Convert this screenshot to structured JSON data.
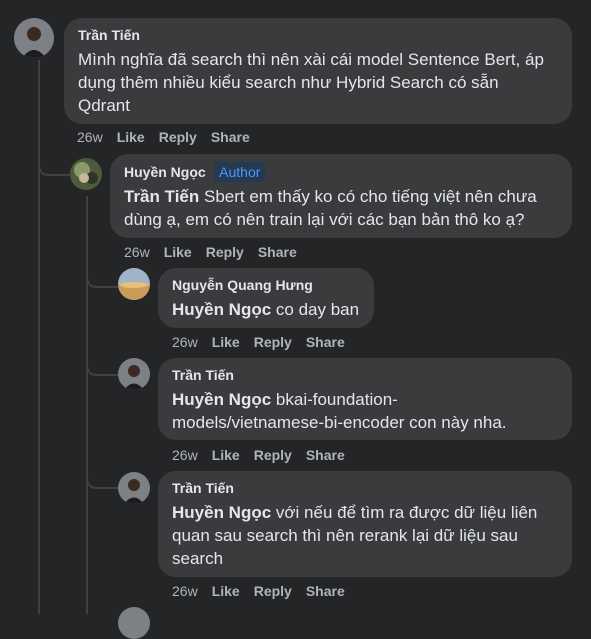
{
  "comments": [
    {
      "author": "Trần Tiến",
      "text": "Mình nghĩa đã search thì nên xài cái model Sentence Bert, áp dụng thêm nhiều kiểu search như Hybrid Search có sẵn Qdrant",
      "line1": "Mình nghĩa đã search thì nên xài cái model Sentence Bert, áp",
      "line2": "dụng thêm nhiều kiểu search như Hybrid Search có sẵn",
      "line3": "Qdrant",
      "time": "26w",
      "like": "Like",
      "reply": "Reply",
      "share": "Share"
    },
    {
      "author": "Huyền Ngọc",
      "badge": "Author",
      "mention": "Trần Tiến",
      "line1": " Sbert em thấy ko có cho tiếng việt nên chưa",
      "line2": "dùng ạ, em có nên train lại với các bạn bản thô ko ạ?",
      "time": "26w",
      "like": "Like",
      "reply": "Reply",
      "share": "Share"
    },
    {
      "author": "Nguyễn Quang Hưng",
      "mention": "Huyền Ngọc",
      "line1": " co day ban",
      "time": "26w",
      "like": "Like",
      "reply": "Reply",
      "share": "Share"
    },
    {
      "author": "Trần Tiến",
      "mention": "Huyền Ngọc",
      "line1": " bkai-foundation-",
      "line2": "models/vietnamese-bi-encoder con này nha.",
      "time": "26w",
      "like": "Like",
      "reply": "Reply",
      "share": "Share"
    },
    {
      "author": "Trần Tiến",
      "mention": "Huyền Ngọc",
      "line1": " với nếu để tìm ra được dữ liệu liên",
      "line2": "quan sau search thì nên rerank lại dữ liệu sau",
      "line3": "search",
      "time": "26w",
      "like": "Like",
      "reply": "Reply",
      "share": "Share"
    }
  ],
  "colors": {
    "background": "#242526",
    "bubble": "#3a3b3c",
    "badge_text": "#4599ff",
    "meta": "#b0b3b8"
  }
}
